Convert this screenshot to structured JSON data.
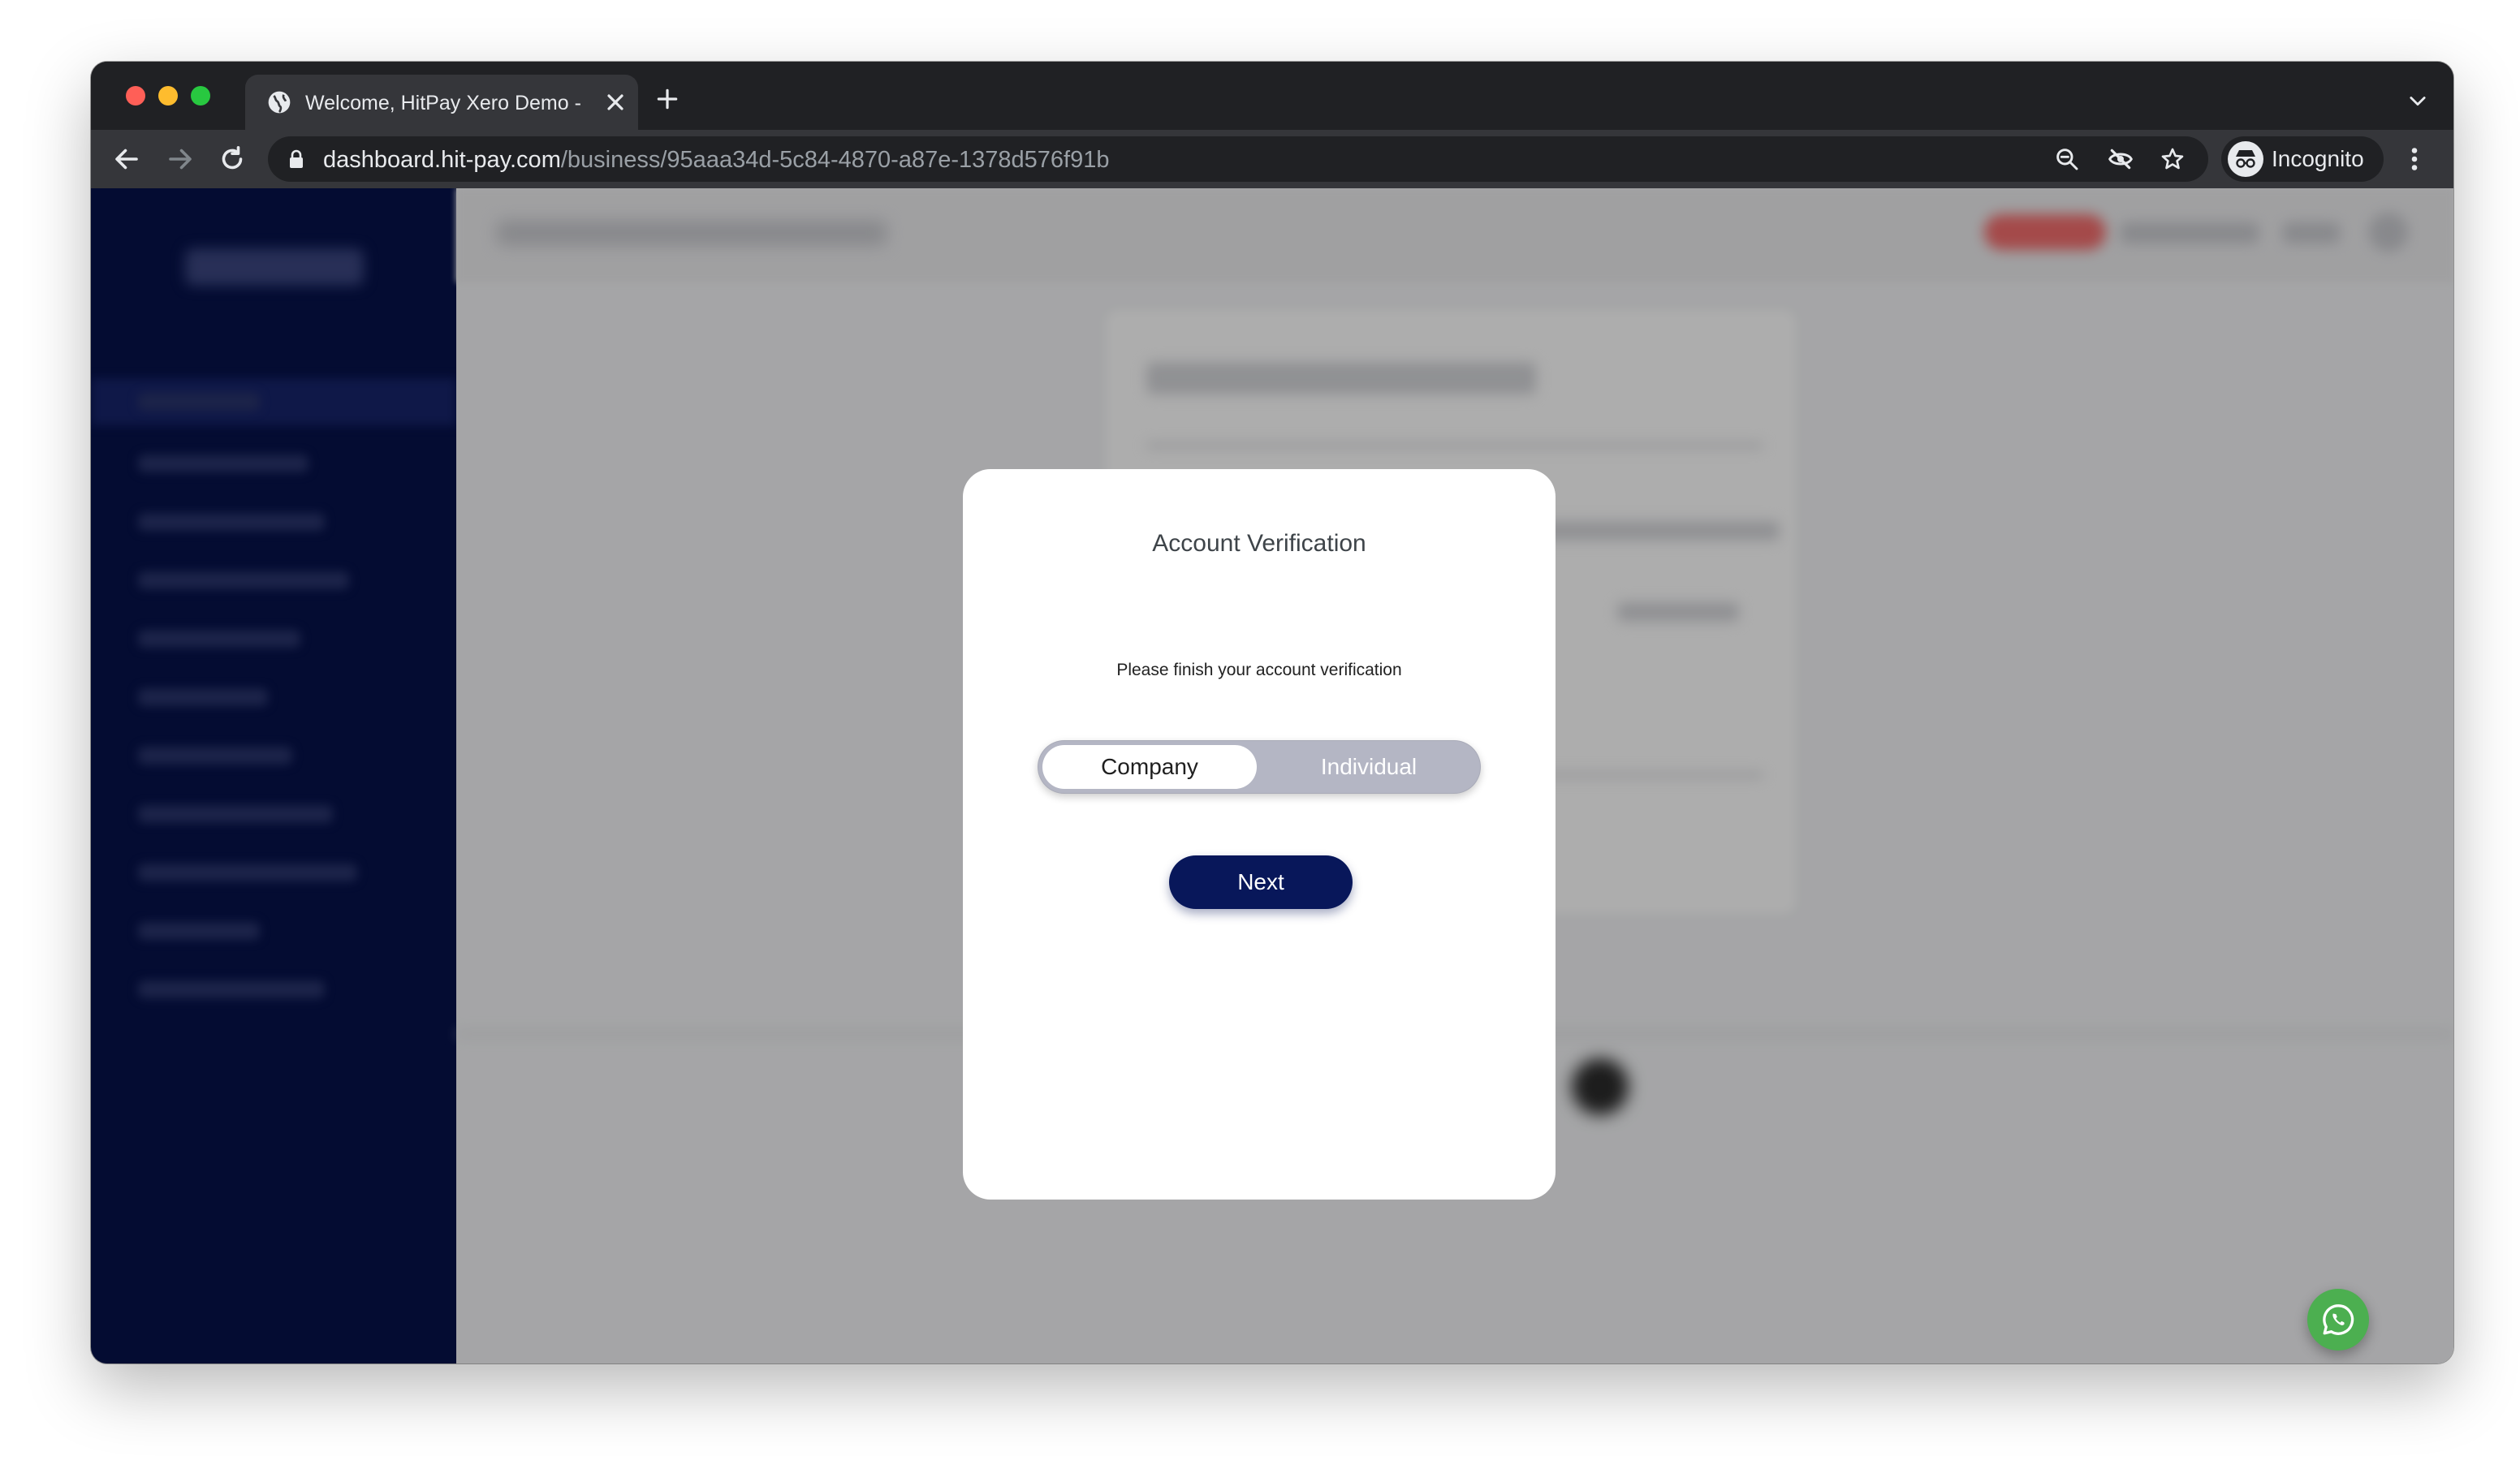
{
  "browser": {
    "tab": {
      "title": "Welcome, HitPay Xero Demo -",
      "favicon": "globe-icon"
    },
    "address_bar": {
      "host": "dashboard.hit-pay.com",
      "path": "/business/95aaa34d-5c84-4870-a87e-1378d576f91b"
    },
    "profile_label": "Incognito"
  },
  "modal": {
    "title": "Account Verification",
    "message": "Please finish your account verification",
    "segment_options": [
      "Company",
      "Individual"
    ],
    "selected_option": "Company",
    "next_label": "Next"
  },
  "colors": {
    "sidebar": "#06124a",
    "primary_button": "#08175a",
    "whatsapp": "#4caf50"
  },
  "icons": {
    "floating_chat": "whatsapp-icon"
  }
}
